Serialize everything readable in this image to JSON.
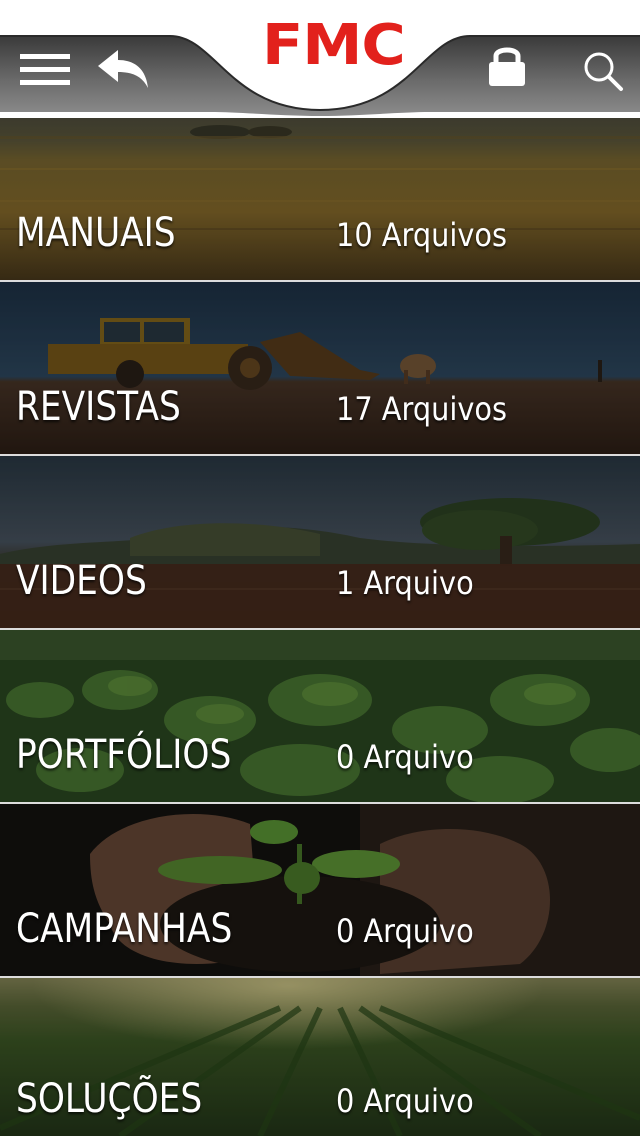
{
  "header": {
    "logo": "FMC",
    "menu_icon": "hamburger-menu-icon",
    "back_icon": "back-arrow-icon",
    "lock_icon": "lock-icon",
    "search_icon": "search-icon",
    "brand_color": "#e2211c"
  },
  "categories": [
    {
      "title": "MANUAIS",
      "count": "10 Arquivos"
    },
    {
      "title": "REVISTAS",
      "count": "17 Arquivos"
    },
    {
      "title": "VIDEOS",
      "count": "1 Arquivo"
    },
    {
      "title": "PORTFÓLIOS",
      "count": "0 Arquivo"
    },
    {
      "title": "CAMPANHAS",
      "count": "0 Arquivo"
    },
    {
      "title": "SOLUÇÕES",
      "count": "0 Arquivo"
    }
  ]
}
